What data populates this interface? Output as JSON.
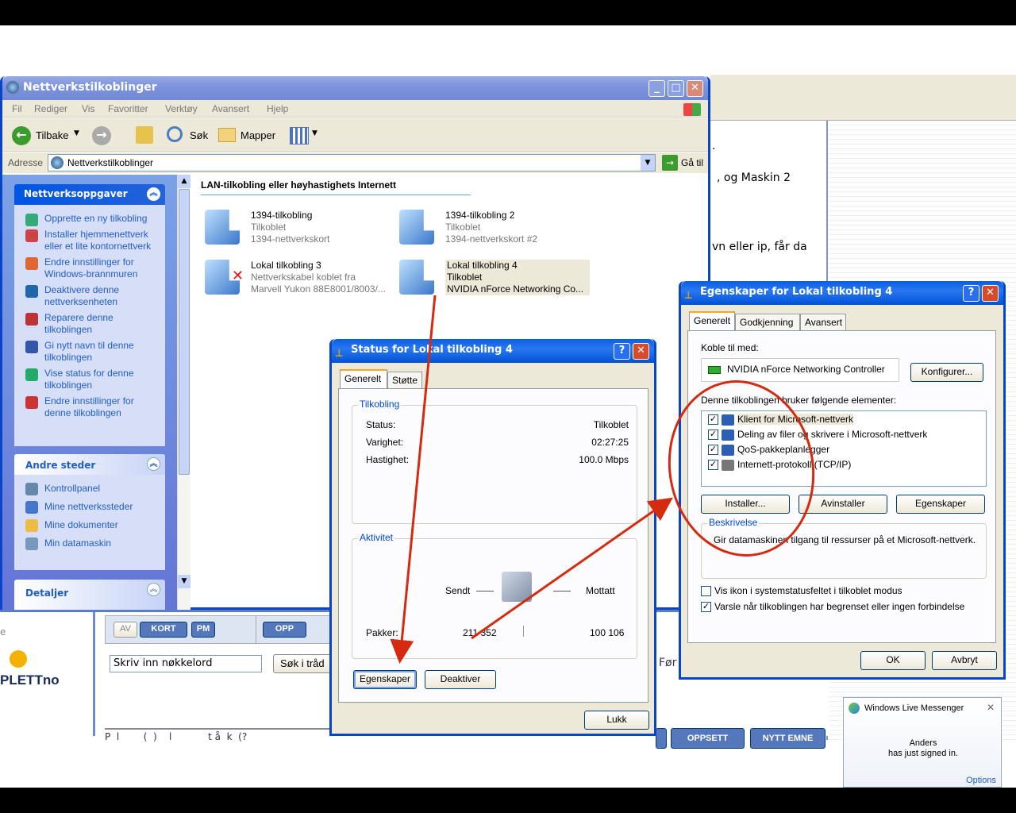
{
  "explorer": {
    "title": "Nettverkstilkoblinger",
    "menu": [
      "Fil",
      "Rediger",
      "Vis",
      "Favoritter",
      "Verktøy",
      "Avansert",
      "Hjelp"
    ],
    "toolbar": {
      "back": "Tilbake",
      "search": "Søk",
      "folders": "Mapper"
    },
    "address_label": "Adresse",
    "address_value": "Nettverkstilkoblinger",
    "go_label": "Gå til",
    "tasks": {
      "title": "Nettverksoppgaver",
      "items": [
        "Opprette en ny tilkobling",
        "Installer hjemmenettverk eller et lite kontornettverk",
        "Endre innstillinger for Windows-brannmuren",
        "Deaktivere denne nettverksenheten",
        "Reparere denne tilkoblingen",
        "Gi nytt navn til denne tilkoblingen",
        "Vise status for denne tilkoblingen",
        "Endre innstillinger for denne tilkoblingen"
      ]
    },
    "places": {
      "title": "Andre steder",
      "items": [
        "Kontrollpanel",
        "Mine nettverkssteder",
        "Mine dokumenter",
        "Min datamaskin"
      ]
    },
    "details": {
      "title": "Detaljer"
    },
    "section_header": "LAN-tilkobling eller høyhastighets Internett",
    "connections": [
      {
        "name": "1394-tilkobling",
        "status": "Tilkoblet",
        "device": "1394-nettverkskort"
      },
      {
        "name": "1394-tilkobling 2",
        "status": "Tilkoblet",
        "device": "1394-nettverkskort #2"
      },
      {
        "name": "Lokal tilkobling 3",
        "status": "Nettverkskabel koblet fra",
        "device": "Marvell Yukon 88E8001/8003/..."
      },
      {
        "name": "Lokal tilkobling 4",
        "status": "Tilkoblet",
        "device": "NVIDIA nForce Networking Co..."
      }
    ]
  },
  "status_dialog": {
    "title": "Status for Lokal tilkobling 4",
    "tabs": [
      "Generelt",
      "Støtte"
    ],
    "conn_group": "Tilkobling",
    "rows": [
      {
        "label": "Status:",
        "value": "Tilkoblet"
      },
      {
        "label": "Varighet:",
        "value": "02:27:25"
      },
      {
        "label": "Hastighet:",
        "value": "100.0 Mbps"
      }
    ],
    "activity_group": "Aktivitet",
    "sent": "Sendt",
    "received": "Mottatt",
    "packets_label": "Pakker:",
    "packets_sent": "211 352",
    "packets_received": "100 106",
    "btn_props": "Egenskaper",
    "btn_disable": "Deaktiver",
    "btn_close": "Lukk"
  },
  "props_dialog": {
    "title": "Egenskaper for Lokal tilkobling 4",
    "tabs": [
      "Generelt",
      "Godkjenning",
      "Avansert"
    ],
    "connect_using": "Koble til med:",
    "adapter": "NVIDIA nForce Networking Controller",
    "configure": "Konfigurer...",
    "items_label": "Denne tilkoblingen bruker følgende elementer:",
    "items": [
      "Klient for Microsoft-nettverk",
      "Deling av filer og skrivere i Microsoft-nettverk",
      "QoS-pakkeplanlegger",
      "Internett-protokoll (TCP/IP)"
    ],
    "btn_install": "Installer...",
    "btn_uninstall": "Avinstaller",
    "btn_props": "Egenskaper",
    "desc_group": "Beskrivelse",
    "desc_text": "Gir datamaskinen tilgang til ressurser på et Microsoft-nettverk.",
    "chk_show_icon": "Vis ikon i systemstatusfeltet i tilkoblet modus",
    "chk_notify": "Varsle når tilkoblingen har begrenset eller ingen forbindelse",
    "ok": "OK",
    "cancel": "Avbryt"
  },
  "background": {
    "text1": ".",
    "text2": ", og Maskin 2",
    "text3": "vn eller ip, får da",
    "search_placeholder": "Skriv inn nøkkelord",
    "search_btn": "Søk i tråd",
    "btn_av": "AV",
    "btn_kort": "KORT",
    "btn_pm": "PM",
    "btn_opp": "OPP",
    "btn_oppsett": "OPPSETT",
    "btn_nytt": "NYTT EMNE",
    "logo": "PLETTno",
    "left_e": "e",
    "for_text": "Før",
    "bottom_text": "P  l        (  )    l            t å  k  (?"
  },
  "messenger": {
    "title": "Windows Live Messenger",
    "name": "Anders",
    "msg": "has just signed in.",
    "options": "Options"
  }
}
